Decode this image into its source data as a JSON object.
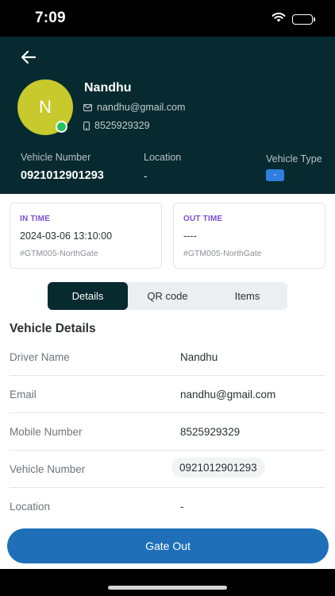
{
  "status_bar": {
    "time": "7:09",
    "icons": [
      "wifi-icon",
      "battery-icon"
    ]
  },
  "header": {
    "back_icon": "arrow-left-icon",
    "avatar_initial": "N",
    "name": "Nandhu",
    "email": "nandhu@gmail.com",
    "phone": "8525929329",
    "vehicle_number_label": "Vehicle Number",
    "vehicle_number": "0921012901293",
    "location_label": "Location",
    "location": "-",
    "vehicle_type_label": "Vehicle Type",
    "vehicle_type": "-"
  },
  "in_time": {
    "label": "IN TIME",
    "value": "2024-03-06 13:10:00",
    "gate": "#GTM005-NorthGate"
  },
  "out_time": {
    "label": "OUT TIME",
    "value": "----",
    "gate": "#GTM005-NorthGate"
  },
  "tabs": [
    {
      "label": "Details",
      "active": true
    },
    {
      "label": "QR code",
      "active": false
    },
    {
      "label": "Items",
      "active": false
    }
  ],
  "details": {
    "title": "Vehicle Details",
    "rows": [
      {
        "label": "Driver Name",
        "value": "Nandhu"
      },
      {
        "label": "Email",
        "value": "nandhu@gmail.com"
      },
      {
        "label": "Mobile Number",
        "value": "8525929329"
      },
      {
        "label": "Vehicle Number",
        "value": "0921012901293"
      },
      {
        "label": "Location",
        "value": "-"
      }
    ]
  },
  "action": {
    "label": "Gate Out"
  },
  "colors": {
    "header_bg": "#062a2f",
    "avatar": "#c7c92c",
    "online": "#22c55e",
    "accent_purple": "#7b4fd6",
    "button": "#1e6fb8",
    "type_chip": "#2f7fe0"
  }
}
